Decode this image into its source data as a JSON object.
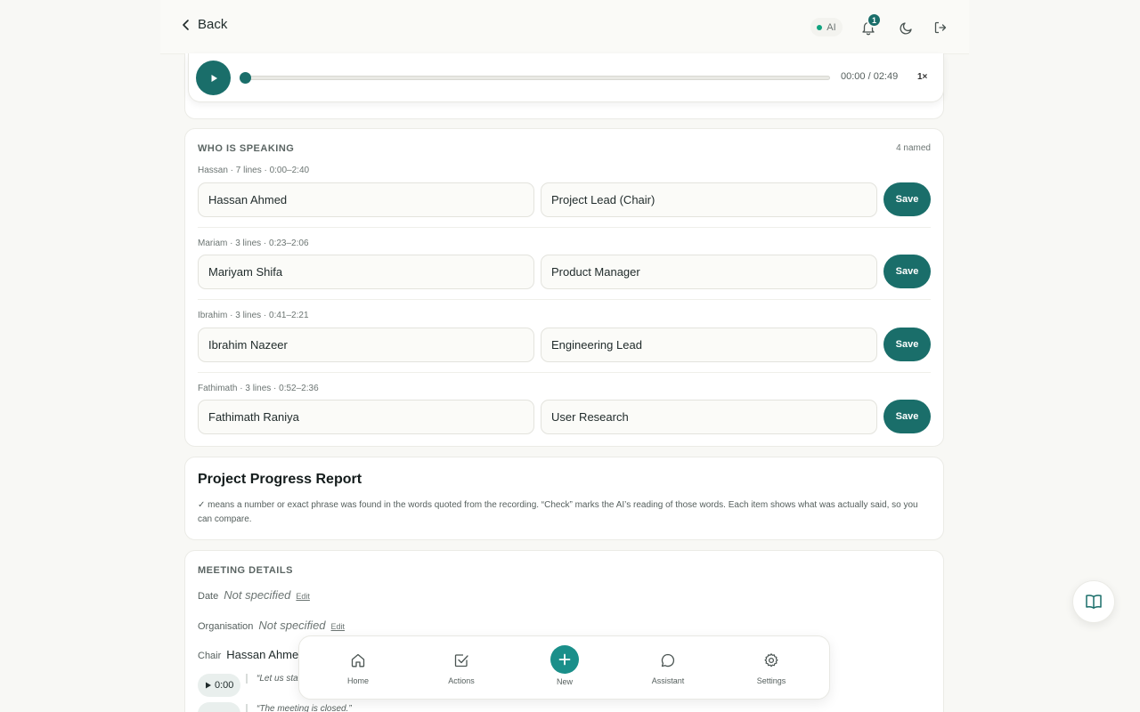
{
  "header": {
    "back_label": "Back",
    "ai_label": "AI",
    "notification_count": "1"
  },
  "player": {
    "current": "00:00",
    "duration": "02:49",
    "time_display": "00:00 / 02:49",
    "speed": "1×",
    "progress": 0
  },
  "speakers": {
    "title": "WHO IS SPEAKING",
    "count_label": "4 named",
    "save_label": "Save",
    "items": [
      {
        "meta": "Hassan · 7 lines · 0:00–2:40",
        "name": "Hassan Ahmed",
        "role": "Project Lead (Chair)"
      },
      {
        "meta": "Mariam · 3 lines · 0:23–2:06",
        "name": "Mariyam Shifa",
        "role": "Product Manager"
      },
      {
        "meta": "Ibrahim · 3 lines · 0:41–2:21",
        "name": "Ibrahim Nazeer",
        "role": "Engineering Lead"
      },
      {
        "meta": "Fathimath · 3 lines · 0:52–2:36",
        "name": "Fathimath Raniya",
        "role": "User Research"
      }
    ]
  },
  "report": {
    "title": "Project Progress Report",
    "description": "✓ means a number or exact phrase was found in the words quoted from the recording. “Check” marks the AI’s reading of those words. Each item shows what was actually said, so you can compare."
  },
  "details": {
    "title": "MEETING DETAILS",
    "date_label": "Date",
    "date_value": "Not specified",
    "org_label": "Organisation",
    "org_value": "Not specified",
    "edit_label": "Edit",
    "chair_label": "Chair",
    "chair_value": "Hassan Ahmed",
    "quotes": [
      {
        "timestamp": "0:00",
        "text": "“Let us start"
      },
      {
        "timestamp": "",
        "text": "“The meeting is closed.”"
      }
    ]
  },
  "nav": {
    "items": [
      {
        "label": "Home",
        "icon": "home-icon"
      },
      {
        "label": "Actions",
        "icon": "checkbox-icon"
      },
      {
        "label": "New",
        "icon": "plus-icon"
      },
      {
        "label": "Assistant",
        "icon": "chat-icon"
      },
      {
        "label": "Settings",
        "icon": "gear-icon"
      }
    ]
  },
  "colors": {
    "accent": "#1a6e6a",
    "ai_status": "#10a37f",
    "background": "#f8f8f5"
  }
}
